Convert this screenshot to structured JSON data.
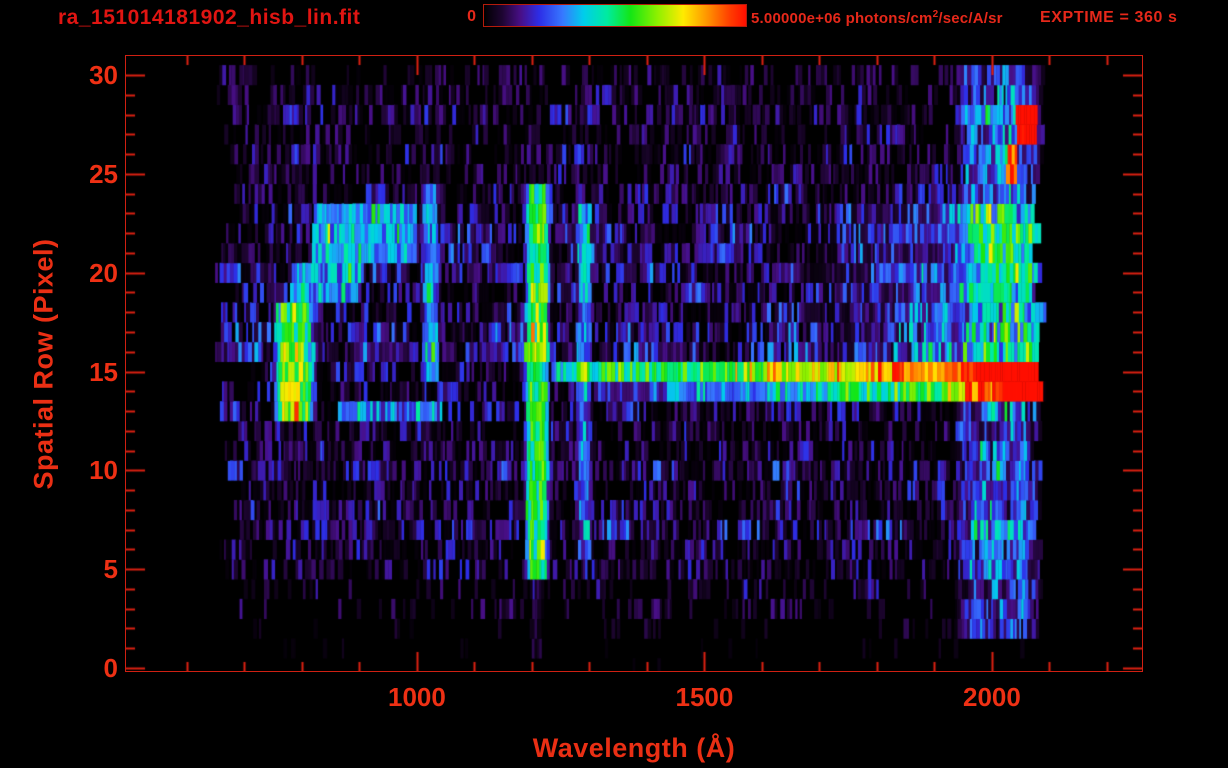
{
  "header": {
    "title": "ra_151014181902_hisb_lin.fit",
    "exptime": "EXPTIME = 360 s"
  },
  "colorbar": {
    "min_label": "0",
    "max_value": "5.00000e+06 ",
    "units_prefix": "photons/cm",
    "units_sup": "2",
    "units_suffix": "/sec/A/sr"
  },
  "chart_data": {
    "type": "heatmap",
    "title": "ra_151014181902_hisb_lin.fit",
    "xlabel": "Wavelength (Å)",
    "ylabel": "Spatial Row (Pixel)",
    "xlim": [
      494,
      2261
    ],
    "ylim": [
      -0.15,
      30.96
    ],
    "xticks": [
      {
        "value": 1000,
        "label": "1000"
      },
      {
        "value": 1500,
        "label": "1500"
      },
      {
        "value": 2000,
        "label": "2000"
      }
    ],
    "yticks": [
      {
        "value": 0,
        "label": "0"
      },
      {
        "value": 5,
        "label": "5"
      },
      {
        "value": 10,
        "label": "10"
      },
      {
        "value": 15,
        "label": "15"
      },
      {
        "value": 20,
        "label": "20"
      },
      {
        "value": 25,
        "label": "25"
      },
      {
        "value": 30,
        "label": "30"
      }
    ],
    "xtick_minor_step": 100,
    "ytick_minor_step": 1,
    "grid": false,
    "colorscale": {
      "min": 0,
      "max": 5000000,
      "units": "photons/cm^2/sec/A/sr"
    },
    "exposure_time_s": 360,
    "data_extent": {
      "wavelength_A": [
        650,
        2090
      ],
      "spatial_rows": [
        0,
        30
      ]
    },
    "colormap_stops": [
      [
        0.0,
        [
          0,
          0,
          0
        ]
      ],
      [
        0.07,
        [
          30,
          5,
          50
        ]
      ],
      [
        0.14,
        [
          72,
          15,
          135
        ]
      ],
      [
        0.21,
        [
          45,
          45,
          230
        ]
      ],
      [
        0.3,
        [
          55,
          120,
          255
        ]
      ],
      [
        0.38,
        [
          0,
          205,
          235
        ]
      ],
      [
        0.47,
        [
          0,
          235,
          160
        ]
      ],
      [
        0.56,
        [
          20,
          230,
          20
        ]
      ],
      [
        0.66,
        [
          140,
          240,
          0
        ]
      ],
      [
        0.76,
        [
          255,
          235,
          0
        ]
      ],
      [
        0.86,
        [
          255,
          140,
          0
        ]
      ],
      [
        0.94,
        [
          255,
          60,
          0
        ]
      ],
      [
        1.0,
        [
          255,
          15,
          0
        ]
      ]
    ],
    "row_background": [
      0.015,
      0.02,
      0.03,
      0.05,
      0.06,
      0.075,
      0.085,
      0.1,
      0.09,
      0.085,
      0.1,
      0.085,
      0.08,
      0.095,
      0.095,
      0.105,
      0.115,
      0.11,
      0.095,
      0.095,
      0.105,
      0.095,
      0.1,
      0.095,
      0.085,
      0.07,
      0.075,
      0.07,
      0.075,
      0.07,
      0.065
    ],
    "row_density": [
      0.04,
      0.06,
      0.1,
      0.25,
      0.3,
      0.45,
      0.5,
      0.62,
      0.55,
      0.5,
      0.62,
      0.55,
      0.5,
      0.58,
      0.58,
      0.62,
      0.72,
      0.68,
      0.58,
      0.58,
      0.68,
      0.6,
      0.64,
      0.6,
      0.55,
      0.45,
      0.5,
      0.45,
      0.5,
      0.46,
      0.42
    ],
    "features": [
      {
        "name": "airglow-arc-left-limb",
        "kind": "vband",
        "lambda": [
          748,
          828
        ],
        "rows": [
          12.6,
          18.6
        ],
        "amp": 0.46,
        "jitter": 0.35
      },
      {
        "name": "airglow-arc-left-core",
        "kind": "vband",
        "lambda": [
          756,
          810
        ],
        "rows": [
          13.0,
          16.6
        ],
        "amp": 0.16,
        "jitter": 0.4
      },
      {
        "name": "airglow-arc-top-limb",
        "kind": "hband",
        "lambda": [
          820,
          1000
        ],
        "rows": [
          20.6,
          23.4
        ],
        "amp": 0.3,
        "jitter": 0.35
      },
      {
        "name": "airglow-arc-mid-bar",
        "kind": "hband",
        "lambda": [
          780,
          900
        ],
        "rows": [
          18.8,
          20.2
        ],
        "amp": 0.26,
        "jitter": 0.35
      },
      {
        "name": "airglow-arc-lower-tail",
        "kind": "hband",
        "lambda": [
          860,
          1045
        ],
        "rows": [
          12.2,
          13.4
        ],
        "amp": 0.2,
        "jitter": 0.35
      },
      {
        "name": "lyman-beta-emission-line-1025",
        "kind": "vband",
        "lambda": [
          1008,
          1040
        ],
        "rows": [
          14.5,
          24.0
        ],
        "amp": 0.26,
        "jitter": 0.35
      },
      {
        "name": "lyman-alpha-emission-line-1216",
        "kind": "vband",
        "lambda": [
          1186,
          1232
        ],
        "rows": [
          4.8,
          24.6
        ],
        "amp": 0.5,
        "jitter": 0.28
      },
      {
        "name": "lyman-alpha-faint-extension",
        "kind": "vband",
        "lambda": [
          1196,
          1220
        ],
        "rows": [
          0.8,
          4.8
        ],
        "amp": 0.05,
        "jitter": 0.9
      },
      {
        "name": "emission-line-1290",
        "kind": "vband",
        "lambda": [
          1276,
          1306
        ],
        "rows": [
          5.8,
          23.6
        ],
        "amp": 0.22,
        "jitter": 0.4
      },
      {
        "name": "target-trace-row15",
        "kind": "trace",
        "lambda": [
          1238,
          2090
        ],
        "rows": [
          14.55,
          15.65
        ],
        "amp0": 0.34,
        "amp1": 1.0,
        "jitter": 0.1
      },
      {
        "name": "target-trace-row14",
        "kind": "trace",
        "lambda": [
          1310,
          2090
        ],
        "rows": [
          13.6,
          14.55
        ],
        "amp0": 0.1,
        "amp1": 0.72,
        "jitter": 0.18
      },
      {
        "name": "trace-end-red-blob",
        "kind": "spot",
        "lambda": [
          2020,
          2090
        ],
        "rows": [
          13.4,
          14.6
        ],
        "amp": 0.5,
        "jitter": 0.15
      },
      {
        "name": "continuum-brightening-right",
        "kind": "ramp",
        "lambda": [
          1690,
          2090
        ],
        "rows": [
          15.8,
          23.6
        ],
        "amp": 0.22,
        "jitter": 0.5
      },
      {
        "name": "right-edge-bright-band",
        "kind": "vband",
        "lambda": [
          1935,
          2090
        ],
        "rows": [
          1.5,
          30.6
        ],
        "amp": 0.2,
        "jitter": 0.85
      },
      {
        "name": "hot-pixels-rows27-28",
        "kind": "spot",
        "lambda": [
          2042,
          2078
        ],
        "rows": [
          26.6,
          28.4
        ],
        "amp": 0.92,
        "jitter": 0.1
      },
      {
        "name": "hot-pixel-row25",
        "kind": "spot",
        "lambda": [
          2028,
          2044
        ],
        "rows": [
          24.6,
          26.2
        ],
        "amp": 0.68,
        "jitter": 0.15
      }
    ]
  }
}
